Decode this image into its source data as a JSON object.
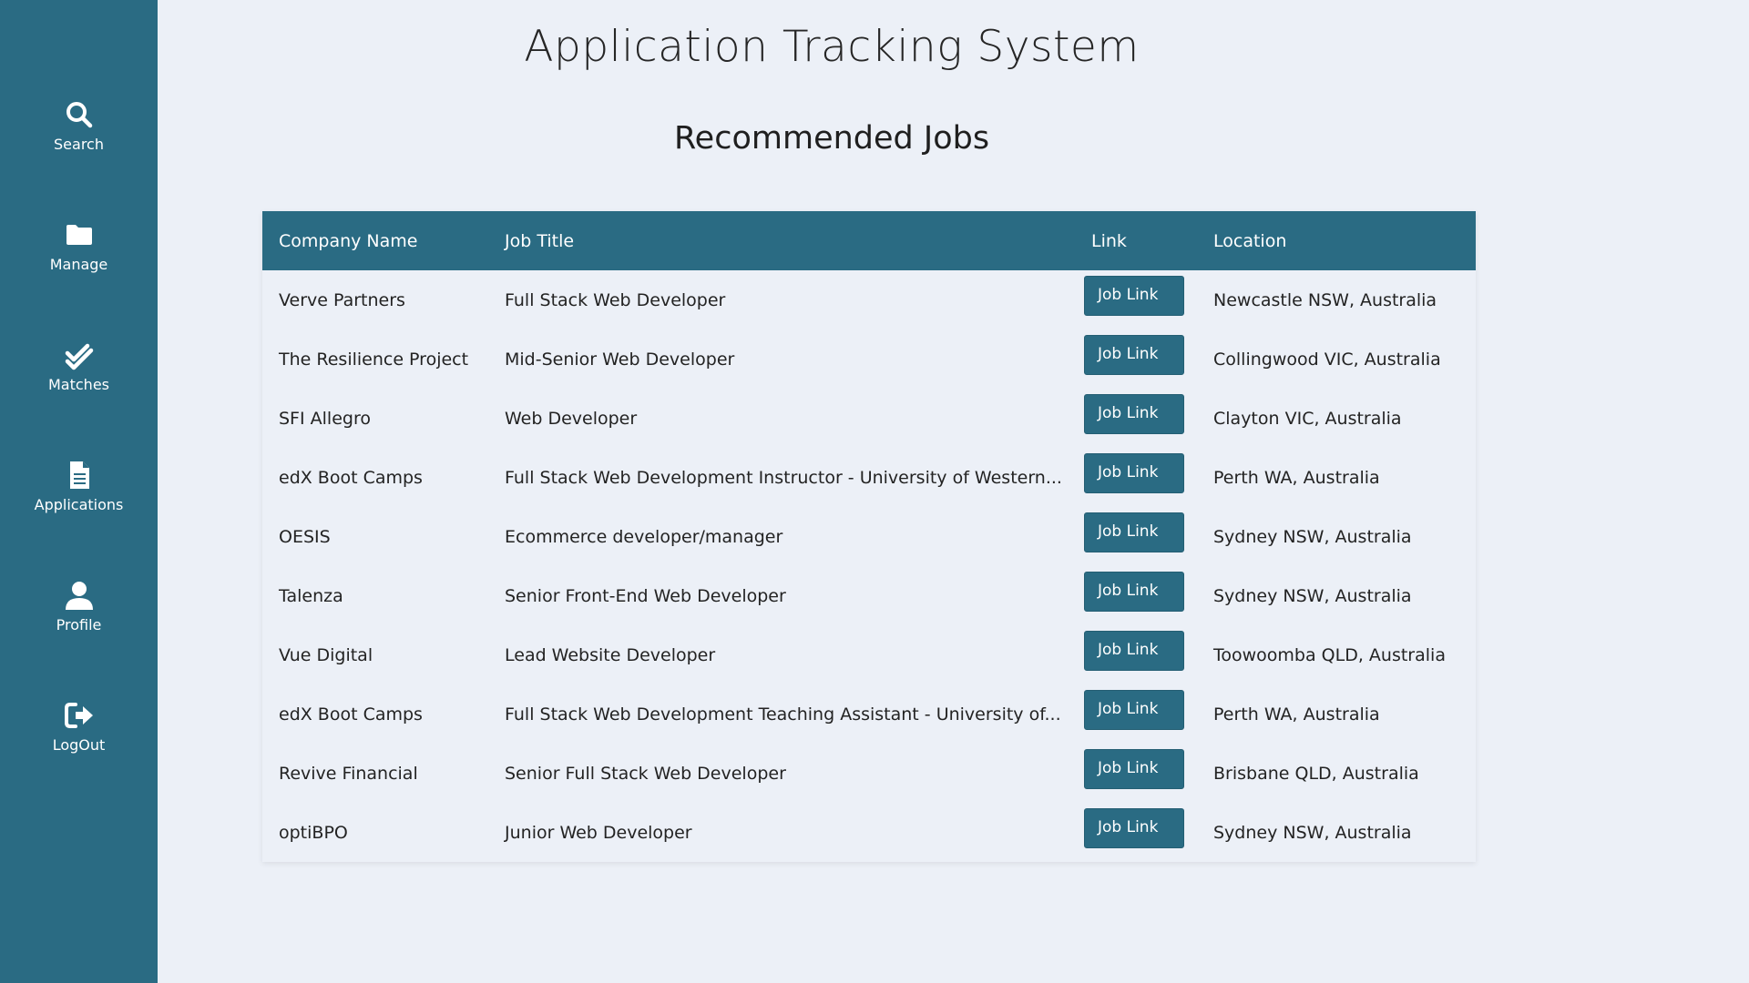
{
  "sidebar": {
    "items": [
      {
        "label": "Search",
        "icon": "search-icon"
      },
      {
        "label": "Manage",
        "icon": "folder-icon"
      },
      {
        "label": "Matches",
        "icon": "double-check-icon"
      },
      {
        "label": "Applications",
        "icon": "document-icon"
      },
      {
        "label": "Profile",
        "icon": "user-icon"
      },
      {
        "label": "LogOut",
        "icon": "logout-icon"
      }
    ]
  },
  "header": {
    "title": "Application Tracking System",
    "section_title": "Recommended Jobs"
  },
  "table": {
    "columns": [
      "Company Name",
      "Job Title",
      "Link",
      "Location"
    ],
    "link_label": "Job Link",
    "rows": [
      {
        "company": "Verve Partners",
        "title": "Full Stack Web Developer",
        "location": "Newcastle NSW, Australia"
      },
      {
        "company": "The Resilience Project",
        "title": "Mid-Senior Web Developer",
        "location": "Collingwood VIC, Australia"
      },
      {
        "company": "SFI Allegro",
        "title": "Web Developer",
        "location": "Clayton VIC, Australia"
      },
      {
        "company": "edX Boot Camps",
        "title": "Full Stack Web Development Instructor - University of Western...",
        "location": "Perth WA, Australia"
      },
      {
        "company": "OESIS",
        "title": "Ecommerce developer/manager",
        "location": "Sydney NSW, Australia"
      },
      {
        "company": "Talenza",
        "title": "Senior Front-End Web Developer",
        "location": "Sydney NSW, Australia"
      },
      {
        "company": "Vue Digital",
        "title": "Lead Website Developer",
        "location": "Toowoomba QLD, Australia"
      },
      {
        "company": "edX Boot Camps",
        "title": "Full Stack Web Development Teaching Assistant - University of...",
        "location": "Perth WA, Australia"
      },
      {
        "company": "Revive Financial",
        "title": "Senior Full Stack Web Developer",
        "location": "Brisbane QLD, Australia"
      },
      {
        "company": "optiBPO",
        "title": "Junior Web Developer",
        "location": "Sydney NSW, Australia"
      }
    ]
  },
  "colors": {
    "sidebar_bg": "#2a6b83",
    "page_bg": "#ecf0f7",
    "header_bg": "#2a6b83",
    "button_bg": "#2a6b83"
  }
}
